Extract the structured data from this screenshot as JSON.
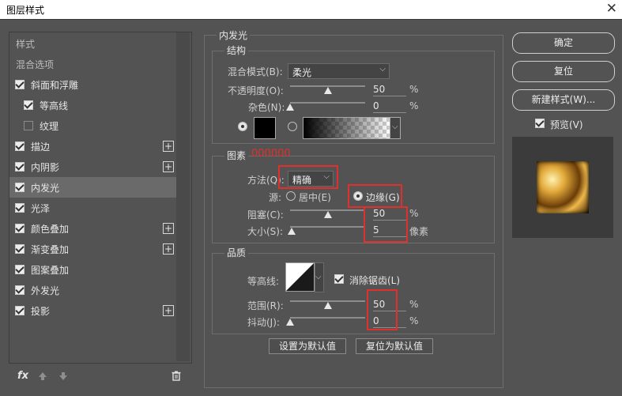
{
  "window": {
    "title": "图层样式",
    "close_glyph": "✕"
  },
  "left_panel": {
    "header": "样式",
    "blend_options": "混合选项",
    "items": [
      {
        "label": "斜面和浮雕",
        "checked": true,
        "plus": false
      },
      {
        "label": "等高线",
        "checked": true,
        "plus": false,
        "indent": true
      },
      {
        "label": "纹理",
        "checked": false,
        "plus": false,
        "indent": true
      },
      {
        "label": "描边",
        "checked": true,
        "plus": true
      },
      {
        "label": "内阴影",
        "checked": true,
        "plus": true
      },
      {
        "label": "内发光",
        "checked": true,
        "plus": false,
        "selected": true
      },
      {
        "label": "光泽",
        "checked": true,
        "plus": false
      },
      {
        "label": "颜色叠加",
        "checked": true,
        "plus": true
      },
      {
        "label": "渐变叠加",
        "checked": true,
        "plus": true
      },
      {
        "label": "图案叠加",
        "checked": true,
        "plus": false
      },
      {
        "label": "外发光",
        "checked": true,
        "plus": false
      },
      {
        "label": "投影",
        "checked": true,
        "plus": true
      }
    ],
    "fx_label": "fx",
    "icons": [
      "fx-icon",
      "arrow-up-icon",
      "arrow-down-icon",
      "trash-icon"
    ]
  },
  "inner_glow": {
    "section_title": "内发光",
    "structure": {
      "title": "结构",
      "blend_mode_label": "混合模式(B):",
      "blend_mode_value": "柔光",
      "opacity_label": "不透明度(O):",
      "opacity_value": "50",
      "opacity_fraction": 0.5,
      "noise_label": "杂色(N):",
      "noise_value": "0",
      "noise_fraction": 0,
      "percent": "%",
      "color": "#000000"
    },
    "elements": {
      "title": "图素",
      "annotation": "000000",
      "technique_label": "方法(Q):",
      "technique_value": "精确",
      "source_label": "源:",
      "source_center": "居中(E)",
      "source_edge": "边缘(G)",
      "choke_label": "阻塞(C):",
      "choke_value": "50",
      "choke_fraction": 0.5,
      "size_label": "大小(S):",
      "size_value": "5",
      "size_fraction": 0.02,
      "percent": "%",
      "pixels": "像素"
    },
    "quality": {
      "title": "品质",
      "contour_label": "等高线:",
      "antialias_label": "消除锯齿(L)",
      "range_label": "范围(R):",
      "range_value": "50",
      "range_fraction": 0.5,
      "jitter_label": "抖动(J):",
      "jitter_value": "0",
      "jitter_fraction": 0,
      "percent": "%"
    },
    "make_default": "设置为默认值",
    "reset_default": "复位为默认值"
  },
  "right_panel": {
    "ok": "确定",
    "reset": "复位",
    "new_style": "新建样式(W)...",
    "preview_label": "预览(V)"
  },
  "colors": {
    "accent_red": "#e0302c",
    "panel_bg": "#535353"
  }
}
